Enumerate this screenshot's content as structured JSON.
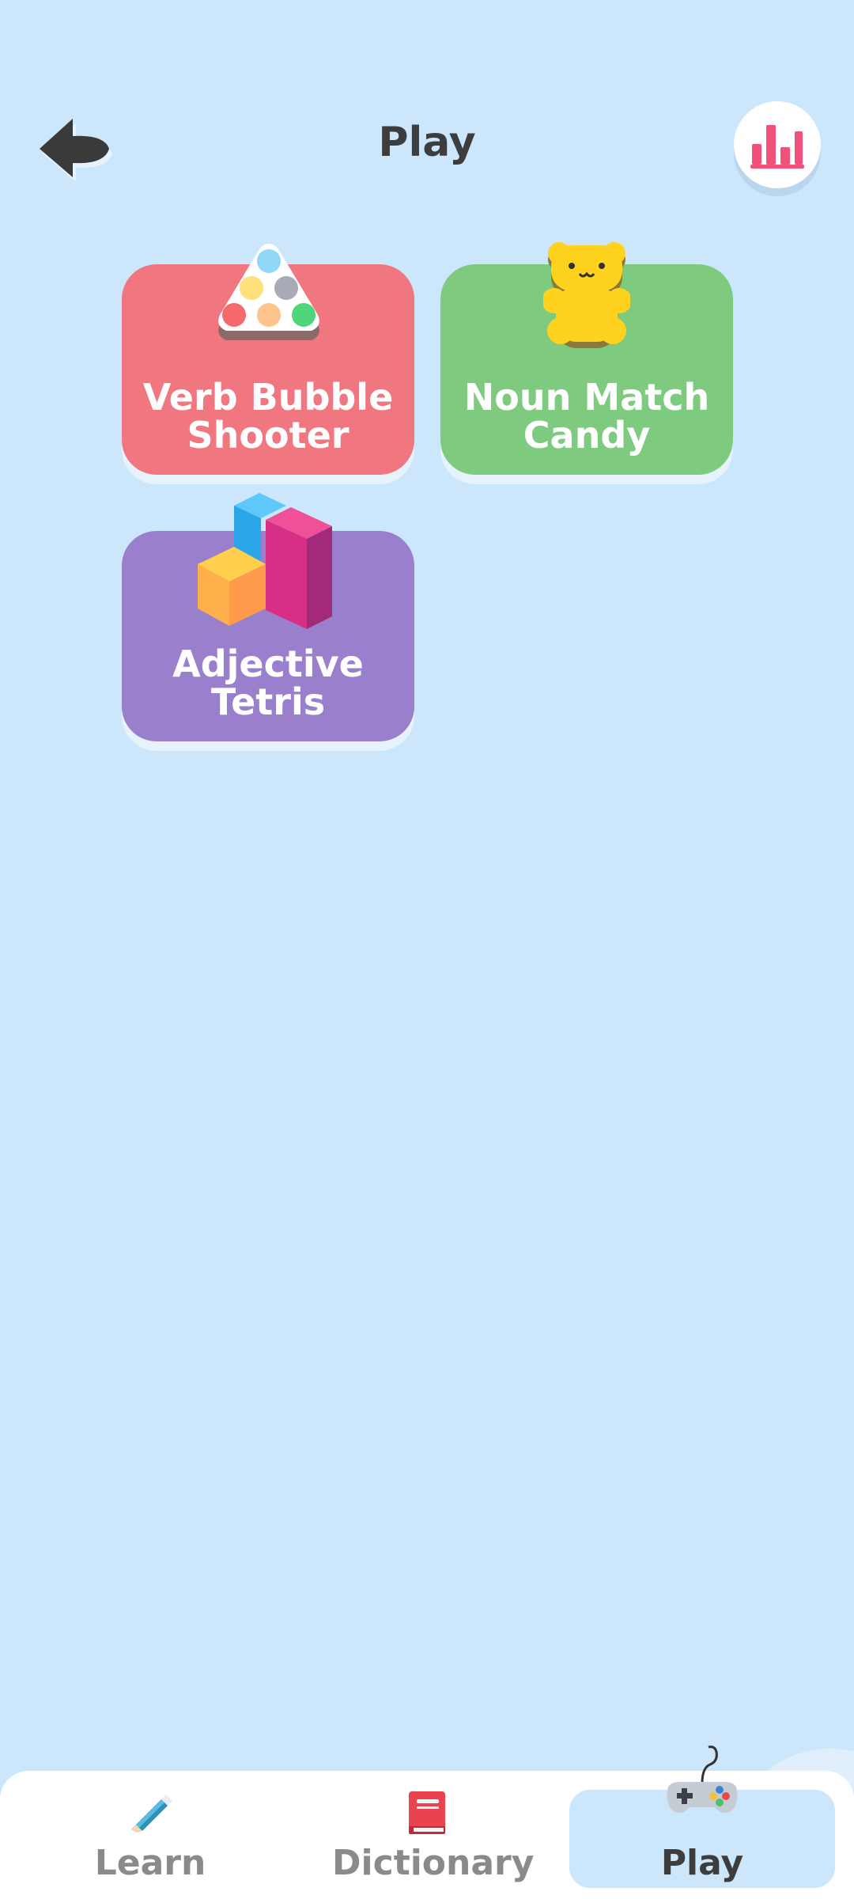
{
  "header": {
    "title": "Play"
  },
  "games": [
    {
      "label_line1": "Verb Bubble",
      "label_line2": "Shooter",
      "color": "#f07680",
      "icon": "bubble-rack-icon"
    },
    {
      "label_line1": "Noun Match",
      "label_line2": "Candy",
      "color": "#7ecb80",
      "icon": "gummy-bear-icon"
    },
    {
      "label_line1": "Adjective",
      "label_line2": "Tetris",
      "color": "#9a80cc",
      "icon": "blocks-icon"
    }
  ],
  "nav": {
    "items": [
      {
        "label": "Learn",
        "icon": "pencil-icon",
        "active": false
      },
      {
        "label": "Dictionary",
        "icon": "book-icon",
        "active": false
      },
      {
        "label": "Play",
        "icon": "gamepad-icon",
        "active": true
      }
    ]
  },
  "colors": {
    "background": "#cce6fb",
    "stats_accent": "#f0507a",
    "text_dark": "#3d3d3d",
    "text_muted": "#8a8a8a"
  }
}
